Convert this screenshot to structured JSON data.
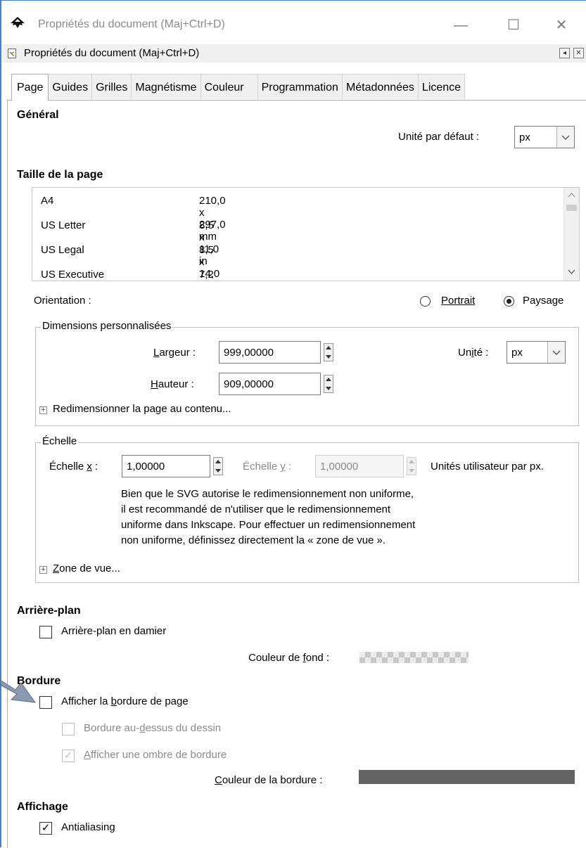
{
  "window": {
    "title": "Propriétés du document (Maj+Ctrl+D)",
    "controls": [
      "—",
      "☐",
      "✕"
    ]
  },
  "dock": {
    "title": "Propriétés du document (Maj+Ctrl+D)",
    "buttons": [
      "◂",
      "✕"
    ]
  },
  "tabs": [
    "Page",
    "Guides",
    "Grilles",
    "Magnétisme",
    "Couleur",
    "Programmation",
    "Métadonnées",
    "Licence"
  ],
  "general": {
    "heading": "Général",
    "default_unit_label": "Unité par défaut :",
    "default_unit_value": "px"
  },
  "page_size": {
    "heading": "Taille de la page",
    "rows": [
      {
        "name": "A4",
        "size": "210,0 x 297,0 mm"
      },
      {
        "name": "US Letter",
        "size": "8,5 x 11,0 in"
      },
      {
        "name": "US Legal",
        "size": "8,5 x 14,0 in"
      },
      {
        "name": "US Executive",
        "size": "7,2 x 10,5 in"
      }
    ],
    "orientation_label": "Orientation :",
    "portrait_label": "Portrait",
    "landscape_label": "Paysage",
    "landscape_selected": true
  },
  "custom_dims": {
    "legend": "Dimensions personnalisées",
    "width_label": "Largeur :",
    "width_value": "999,00000",
    "height_label": "Hauteur :",
    "height_value": "909,00000",
    "unit_label": "Unité :",
    "unit_value": "px",
    "resize_label": "Redimensionner la page au contenu..."
  },
  "scale": {
    "legend": "Échelle",
    "x_label": "Échelle x :",
    "x_value": "1,00000",
    "y_label": "Échelle y :",
    "y_value": "1,00000",
    "units_label": "Unités utilisateur par px.",
    "note_lines": [
      "Bien que le SVG autorise le redimensionnement non uniforme,",
      "il est recommandé de n'utiliser que le redimensionnement",
      "uniforme dans Inkscape. Pour effectuer un redimensionnement",
      "non uniforme, définissez directement la « zone de vue »."
    ],
    "viewbox_label": "Zone de vue..."
  },
  "background": {
    "heading": "Arrière-plan",
    "checkerboard_label": "Arrière-plan en damier",
    "checkerboard_checked": false,
    "color_label": "Couleur de fond :"
  },
  "border": {
    "heading": "Bordure",
    "show_border_label": "Afficher la bordure de page",
    "show_border_checked": false,
    "border_on_top_label": "Bordure au-dessus du dessin",
    "show_shadow_label": "Afficher une ombre de bordure",
    "show_shadow_checked": true,
    "color_label": "Couleur de la bordure :",
    "color": "#646464"
  },
  "display": {
    "heading": "Affichage",
    "antialiasing_label": "Antialiasing",
    "antialiasing_checked": true
  }
}
